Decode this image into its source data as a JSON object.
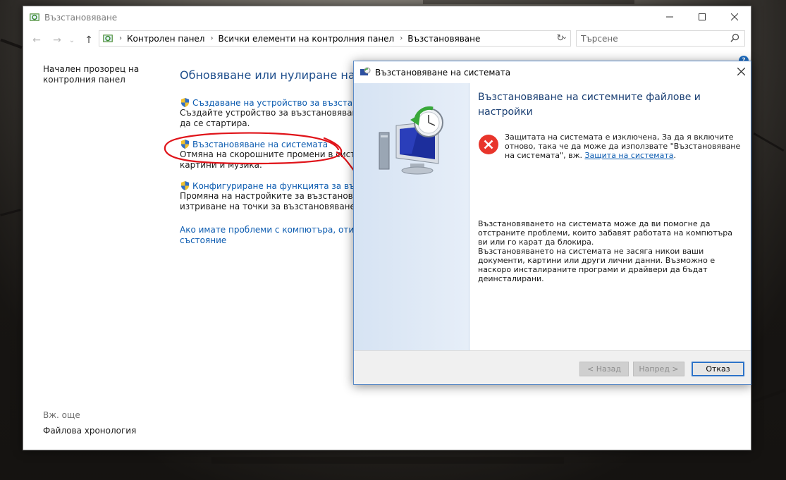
{
  "colors": {
    "title_blue": "#1e4e8c",
    "link_blue": "#0b5bb0",
    "annotation_red": "#e0141a",
    "dialog_side": "#d6e3f3"
  },
  "cp_window": {
    "title": "Възстановяване",
    "title_icon": "recovery-icon",
    "controls": {
      "minimize": "—",
      "maximize": "☐",
      "close": "✕"
    },
    "nav": {
      "back": "←",
      "forward": "→",
      "recent": "⌄",
      "up": "↑",
      "breadcrumbs": [
        "Контролен панел",
        "Всички елементи на контролния панел",
        "Възстановяване"
      ],
      "refresh": "↻",
      "search_placeholder": "Търсене"
    },
    "help": "?",
    "left_pane": {
      "home_link": "Начален прозорец на контролния панел",
      "see_also": "Вж. още",
      "file_history": "Файлова хронология"
    },
    "main": {
      "heading": "Обновяване или нулиране на компютъра",
      "tasks": [
        {
          "link": "Създаване на устройство за възстановяване",
          "desc": [
            "Създайте устройство за възстановяване за отстраняване на проблеми,",
            "да се стартира."
          ]
        },
        {
          "link": "Възстановяване на системата",
          "desc": [
            "Отмяна на скорошните промени в системата, но документи,",
            "картини и музика."
          ]
        },
        {
          "link": "Конфигуриране на функцията за възстановяване на системата",
          "desc": [
            "Промяна на настройките за възстановяване, управление на дисково място и",
            "изтриване на точки за възстановяване."
          ]
        }
      ],
      "problem_link": [
        "Ако имате проблеми с компютъра, отидете в Настройки и",
        "състояние"
      ]
    }
  },
  "dialog": {
    "title": "Възстановяване на системата",
    "close": "✕",
    "heading": "Възстановяване на системните файлове и настройки",
    "error_text": "Защитата на системата е изключена, За да я включите отново, така че да може да използвате \"Възстановяване на системата\", вж. ",
    "error_link": "Защита на системата",
    "error_end": ".",
    "info": [
      "Възстановяването на системата може да ви помогне да отстраните проблеми, които забавят работата на компютъра ви или го карат да блокира.",
      "Възстановяването на системата не засяга никои ваши документи, картини или други лични данни. Възможно е наскоро инсталираните програми и драйвери да бъдат деинсталирани."
    ],
    "buttons": {
      "back": "< Назад",
      "next": "Напред >",
      "cancel": "Отказ"
    }
  }
}
